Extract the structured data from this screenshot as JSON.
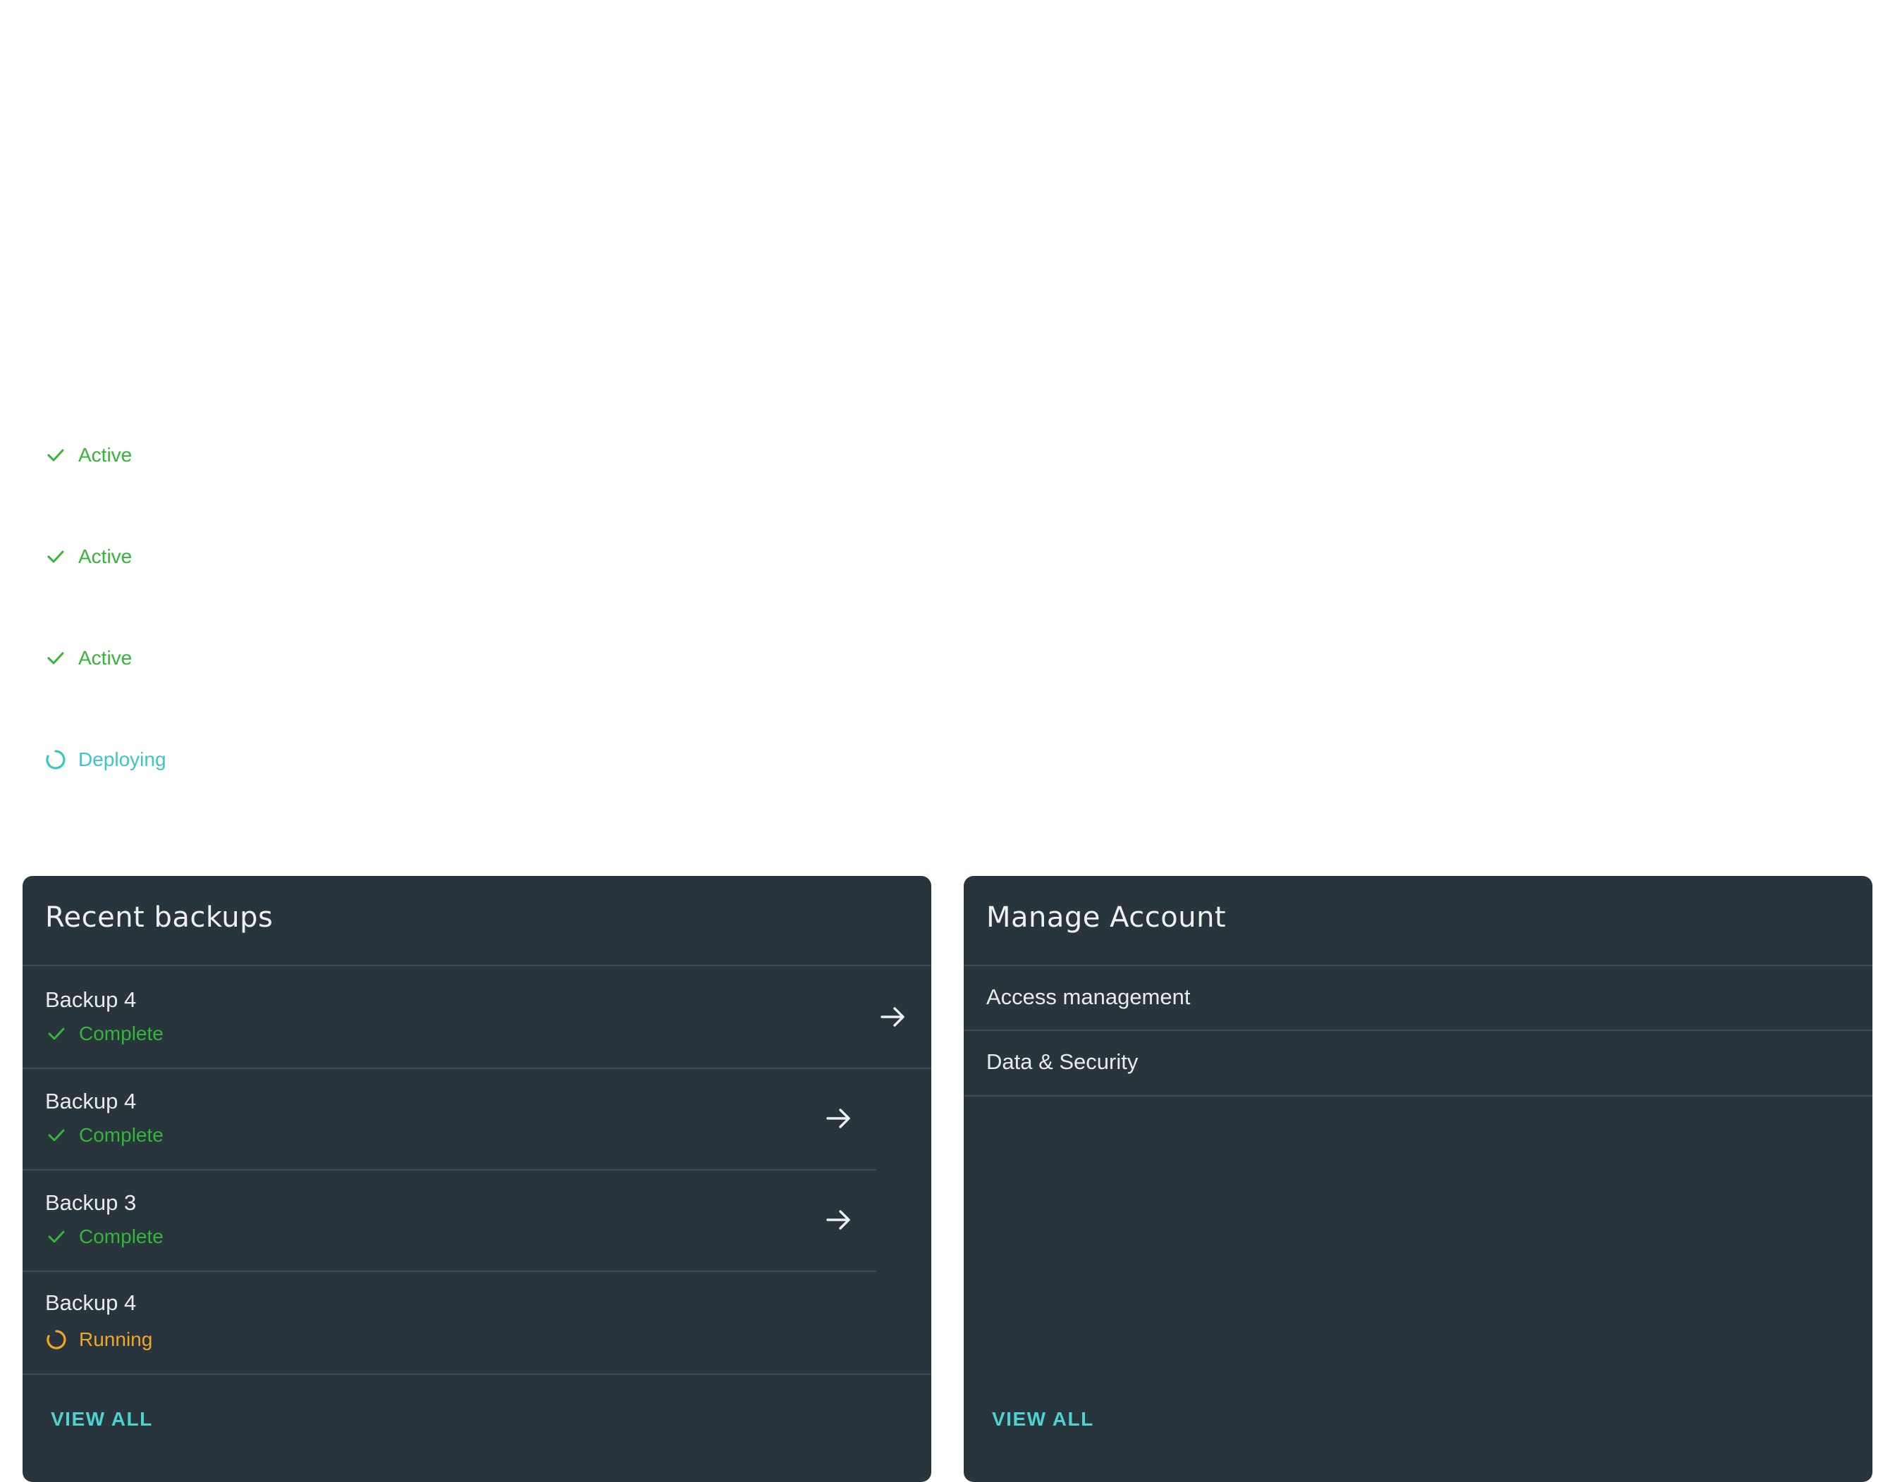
{
  "status_list": [
    {
      "label": "Active",
      "state": "check"
    },
    {
      "label": "Active",
      "state": "check"
    },
    {
      "label": "Active",
      "state": "check"
    },
    {
      "label": "Deploying",
      "state": "spinner"
    }
  ],
  "recent_backups": {
    "title": "Recent backups",
    "items": [
      {
        "name": "Backup 4",
        "status": "Complete"
      },
      {
        "name": "Backup 4",
        "status": "Complete"
      },
      {
        "name": "Backup 3",
        "status": "Complete"
      },
      {
        "name": "Backup 4",
        "status": "Running"
      }
    ],
    "view_all": "VIEW ALL"
  },
  "manage_account": {
    "title": "Manage Account",
    "items": [
      {
        "label": "Access management"
      },
      {
        "label": "Data & Security"
      }
    ],
    "view_all": "VIEW ALL"
  },
  "colors": {
    "card_bg": "#29353c",
    "success": "#34b53a",
    "info": "#3cc6c6",
    "warning": "#f2a628",
    "link": "#4fd1d1"
  },
  "icons": {
    "complete": "check-icon",
    "running": "spinner-icon",
    "deploying": "spinner-icon",
    "row_action": "arrow-right-icon"
  }
}
